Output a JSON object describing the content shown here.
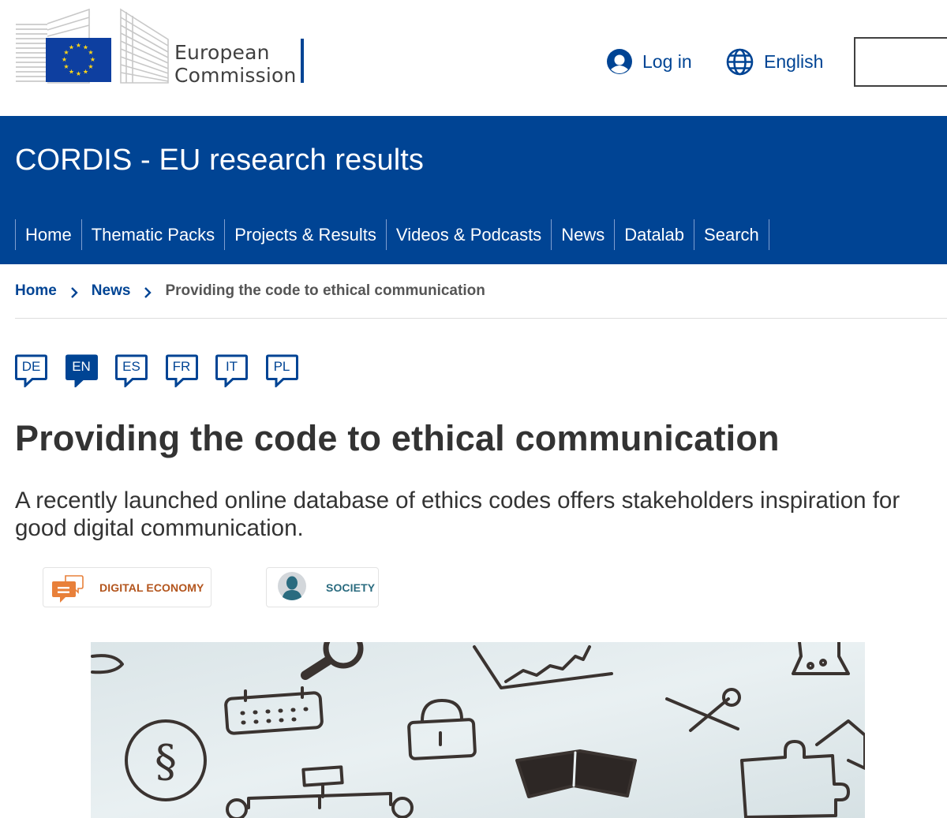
{
  "header": {
    "logo_line1": "European",
    "logo_line2": "Commission",
    "login_label": "Log in",
    "language_label": "English",
    "search_placeholder": ""
  },
  "site": {
    "title": "CORDIS - EU research results"
  },
  "nav": {
    "items": [
      {
        "label": "Home"
      },
      {
        "label": "Thematic Packs"
      },
      {
        "label": "Projects & Results"
      },
      {
        "label": "Videos & Podcasts"
      },
      {
        "label": "News"
      },
      {
        "label": "Datalab"
      },
      {
        "label": "Search"
      }
    ]
  },
  "breadcrumb": {
    "home": "Home",
    "news": "News",
    "current": "Providing the code to ethical communication"
  },
  "languages": {
    "items": [
      {
        "code": "DE",
        "active": false
      },
      {
        "code": "EN",
        "active": true
      },
      {
        "code": "ES",
        "active": false
      },
      {
        "code": "FR",
        "active": false
      },
      {
        "code": "IT",
        "active": false
      },
      {
        "code": "PL",
        "active": false
      }
    ]
  },
  "article": {
    "title": "Providing the code to ethical communication",
    "lead": "A recently launched online database of ethics codes offers stakeholders inspiration for good digital communication."
  },
  "tags": {
    "digital_economy": "DIGITAL ECONOMY",
    "society": "SOCIETY"
  },
  "colors": {
    "brand_blue": "#004494",
    "eu_yellow": "#ffd617",
    "digital_orange": "#e8803a",
    "society_teal": "#2a6b7f"
  }
}
